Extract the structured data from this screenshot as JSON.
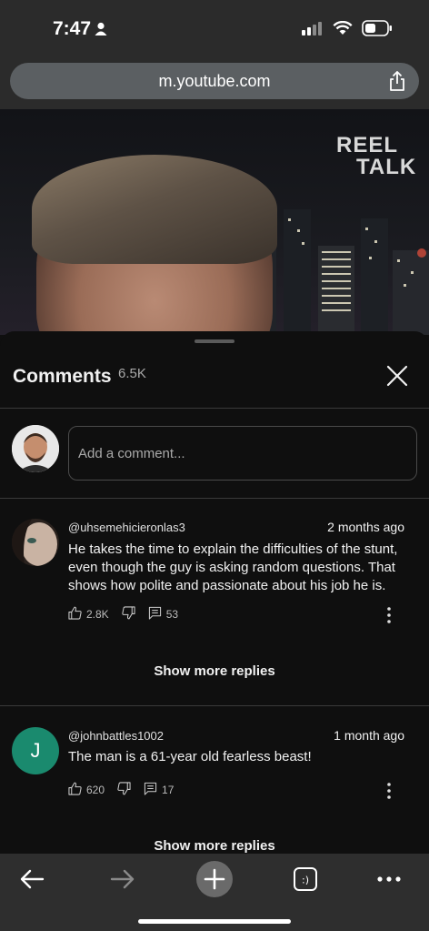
{
  "status_bar": {
    "time": "7:47",
    "icons": [
      "person-icon",
      "signal-icon",
      "wifi-icon",
      "battery-icon"
    ]
  },
  "browser": {
    "url": "m.youtube.com",
    "share_icon": "share-icon"
  },
  "video": {
    "logo_line1": "REEL",
    "logo_line2": "TALK"
  },
  "comments_panel": {
    "title": "Comments",
    "count": "6.5K",
    "add_comment_placeholder": "Add a comment...",
    "comments": [
      {
        "author": "@uhsemehicieronlas3",
        "time": "2 months ago",
        "text": "He takes the time to explain the difficulties of the stunt, even though the guy is asking random questions. That shows how polite and passionate about his job he is.",
        "likes": "2.8K",
        "replies": "53",
        "show_more": "Show more replies"
      },
      {
        "author": "@johnbattles1002",
        "avatar_letter": "J",
        "avatar_color": "#1a8a6e",
        "time": "1 month ago",
        "text": "The man is a 61-year old fearless beast!",
        "likes": "620",
        "replies": "17",
        "show_more": "Show more replies"
      }
    ]
  },
  "bottom_nav": {
    "tabs_label": ":)",
    "icons": [
      "back-arrow-icon",
      "forward-arrow-icon",
      "plus-icon",
      "tabs-icon",
      "more-dots-icon"
    ]
  }
}
